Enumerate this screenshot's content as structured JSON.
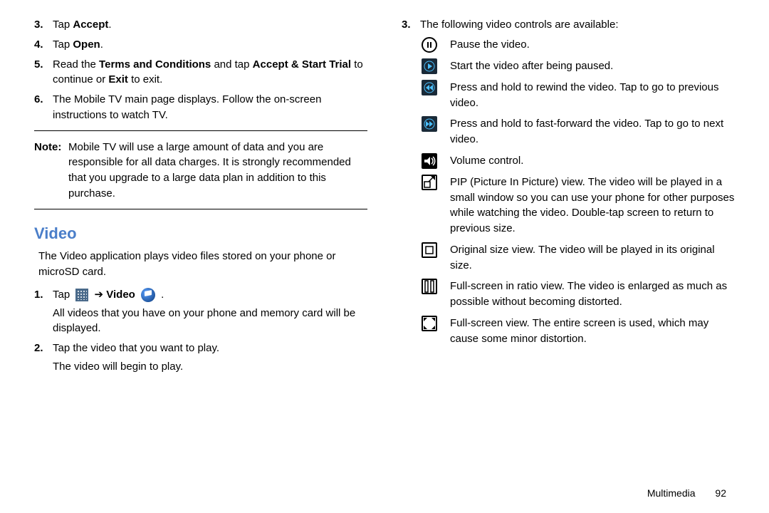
{
  "left": {
    "steps_a": [
      {
        "num": "3.",
        "html": "Tap <b>Accept</b>."
      },
      {
        "num": "4.",
        "html": "Tap <b>Open</b>."
      },
      {
        "num": "5.",
        "html": "Read the <b>Terms and Conditions</b> and tap <b>Accept & Start Trial</b> to continue or <b>Exit</b> to exit."
      },
      {
        "num": "6.",
        "html": "The Mobile TV main page displays. Follow the on-screen instructions to watch TV."
      }
    ],
    "note_label": "Note:",
    "note_body": "Mobile TV will use a large amount of data and you are responsible for all data charges. It is strongly recommended that you upgrade to a large data plan in addition to this purchase.",
    "heading": "Video",
    "intro": "The Video application plays video files stored on your phone or microSD card.",
    "steps_b": [
      {
        "num": "1.",
        "prefix": "Tap ",
        "mid_bold": "Video",
        "suffix": " .",
        "sub": "All videos that you have on your phone and memory card will be displayed."
      },
      {
        "num": "2.",
        "text": "Tap the video that you want to play.",
        "sub": "The video will begin to play."
      }
    ]
  },
  "right": {
    "lead_num": "3.",
    "lead_text": "The following video controls are available:",
    "controls": [
      {
        "icon": "pause-ring",
        "desc": "Pause the video."
      },
      {
        "icon": "play-dark",
        "desc": "Start the video after being paused."
      },
      {
        "icon": "rew-dark",
        "desc": "Press and hold to rewind the video. Tap to go to previous video."
      },
      {
        "icon": "ff-dark",
        "desc": "Press and hold to fast-forward the video. Tap to go to next video."
      },
      {
        "icon": "volume-black",
        "desc": "Volume control."
      },
      {
        "icon": "pip-outline",
        "desc": "PIP (Picture In Picture) view. The video will be played in a small window so you can use your phone for other purposes while watching the video. Double-tap screen to return to previous size."
      },
      {
        "icon": "original-outline",
        "desc": "Original size view. The video will be played in its original size."
      },
      {
        "icon": "ratio-outline",
        "desc": "Full-screen in ratio view. The video is enlarged as much as possible without becoming distorted."
      },
      {
        "icon": "full-outline",
        "desc": "Full-screen view. The entire screen is used, which may cause some minor distortion."
      }
    ]
  },
  "footer": {
    "section": "Multimedia",
    "page": "92"
  }
}
